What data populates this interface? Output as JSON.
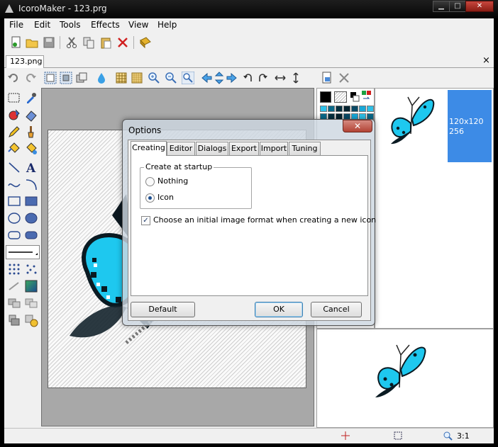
{
  "window": {
    "title": "IcoroMaker - 123.prg"
  },
  "menu": [
    "File",
    "Edit",
    "Tools",
    "Effects",
    "View",
    "Help"
  ],
  "document": {
    "tab": "123.png",
    "close_glyph": "×"
  },
  "preview": {
    "format_line1": "120x120",
    "format_line2": "256"
  },
  "status": {
    "zoom": "3:1"
  },
  "dialog": {
    "title": "Options",
    "close_glyph": "✕",
    "tabs": [
      "Creating",
      "Editor",
      "Dialogs",
      "Export",
      "Import",
      "Tuning"
    ],
    "active_tab": "Creating",
    "group_label": "Create at startup",
    "radio_nothing": "Nothing",
    "radio_icon": "Icon",
    "selected_radio": "Icon",
    "checkbox_label": "Choose an initial image format when creating a new icon",
    "checkbox_checked": true,
    "buttons": {
      "default": "Default",
      "ok": "OK",
      "cancel": "Cancel"
    }
  },
  "colors": {
    "accent": "#3d8be6",
    "butterfly": "#1ec8ef",
    "butterfly_dark": "#0a1a22"
  }
}
